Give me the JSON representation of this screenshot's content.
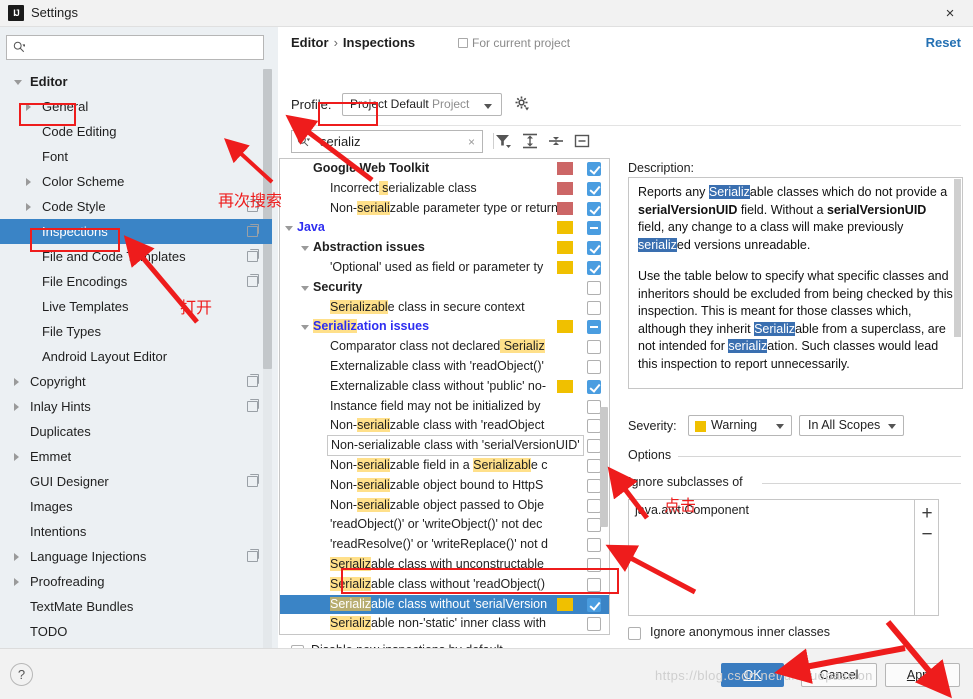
{
  "window": {
    "title": "Settings",
    "app_icon": "IJ",
    "close_icon": "×"
  },
  "sidebar": {
    "search_placeholder": "",
    "search_value": "",
    "items": [
      {
        "label": "Editor",
        "indent": 0,
        "arrow": "down",
        "copy": false,
        "selected": false,
        "bold": true
      },
      {
        "label": "General",
        "indent": 1,
        "arrow": "right",
        "copy": false,
        "selected": false,
        "bold": false
      },
      {
        "label": "Code Editing",
        "indent": 1,
        "arrow": "none",
        "copy": false,
        "selected": false,
        "bold": false
      },
      {
        "label": "Font",
        "indent": 1,
        "arrow": "none",
        "copy": false,
        "selected": false,
        "bold": false
      },
      {
        "label": "Color Scheme",
        "indent": 1,
        "arrow": "right",
        "copy": false,
        "selected": false,
        "bold": false
      },
      {
        "label": "Code Style",
        "indent": 1,
        "arrow": "right",
        "copy": true,
        "selected": false,
        "bold": false
      },
      {
        "label": "Inspections",
        "indent": 1,
        "arrow": "none",
        "copy": true,
        "selected": true,
        "bold": false
      },
      {
        "label": "File and Code Templates",
        "indent": 1,
        "arrow": "none",
        "copy": true,
        "selected": false,
        "bold": false
      },
      {
        "label": "File Encodings",
        "indent": 1,
        "arrow": "none",
        "copy": true,
        "selected": false,
        "bold": false
      },
      {
        "label": "Live Templates",
        "indent": 1,
        "arrow": "none",
        "copy": false,
        "selected": false,
        "bold": false
      },
      {
        "label": "File Types",
        "indent": 1,
        "arrow": "none",
        "copy": false,
        "selected": false,
        "bold": false
      },
      {
        "label": "Android Layout Editor",
        "indent": 1,
        "arrow": "none",
        "copy": false,
        "selected": false,
        "bold": false
      },
      {
        "label": "Copyright",
        "indent": 0,
        "arrow": "right",
        "copy": true,
        "selected": false,
        "bold": false
      },
      {
        "label": "Inlay Hints",
        "indent": 0,
        "arrow": "right",
        "copy": true,
        "selected": false,
        "bold": false
      },
      {
        "label": "Duplicates",
        "indent": 0,
        "arrow": "none",
        "copy": false,
        "selected": false,
        "bold": false
      },
      {
        "label": "Emmet",
        "indent": 0,
        "arrow": "right",
        "copy": false,
        "selected": false,
        "bold": false
      },
      {
        "label": "GUI Designer",
        "indent": 0,
        "arrow": "none",
        "copy": true,
        "selected": false,
        "bold": false
      },
      {
        "label": "Images",
        "indent": 0,
        "arrow": "none",
        "copy": false,
        "selected": false,
        "bold": false
      },
      {
        "label": "Intentions",
        "indent": 0,
        "arrow": "none",
        "copy": false,
        "selected": false,
        "bold": false
      },
      {
        "label": "Language Injections",
        "indent": 0,
        "arrow": "right",
        "copy": true,
        "selected": false,
        "bold": false
      },
      {
        "label": "Proofreading",
        "indent": 0,
        "arrow": "right",
        "copy": false,
        "selected": false,
        "bold": false
      },
      {
        "label": "TextMate Bundles",
        "indent": 0,
        "arrow": "none",
        "copy": false,
        "selected": false,
        "bold": false
      },
      {
        "label": "TODO",
        "indent": 0,
        "arrow": "none",
        "copy": false,
        "selected": false,
        "bold": false
      }
    ]
  },
  "header": {
    "breadcrumb_parent": "Editor",
    "breadcrumb_sep": "›",
    "breadcrumb_current": "Inspections",
    "for_current_project": "For current project",
    "reset": "Reset",
    "profile_label": "Profile:",
    "profile_value": "Project Default",
    "profile_scope": "Project",
    "gear_icon": "gear-icon"
  },
  "inspection_search": {
    "value": "serializ",
    "clear_icon": "×",
    "filter_icon": "filter-icon",
    "expand_all_icon": "expand-all-icon",
    "collapse_all_icon": "collapse-all-icon",
    "collapse_box_icon": "collapse-box-icon"
  },
  "inspection_tree": {
    "tooltip": "Non-serializable class with 'serialVersionUID'",
    "rows": [
      {
        "label": "Google Web Toolkit",
        "indent": 1,
        "arrow": "none",
        "bold": true,
        "blue": false,
        "severity": "error",
        "check": "on",
        "selected": false,
        "marks": []
      },
      {
        "label": "Incorrect serializable class",
        "indent": 2,
        "arrow": "none",
        "bold": false,
        "blue": false,
        "severity": "error",
        "check": "on",
        "selected": false,
        "marks": [
          [
            9,
            11
          ]
        ]
      },
      {
        "label": "Non-serializable parameter type or return",
        "indent": 2,
        "arrow": "none",
        "bold": false,
        "blue": false,
        "severity": "error",
        "check": "on",
        "selected": false,
        "marks": [
          [
            4,
            11
          ]
        ]
      },
      {
        "label": "Java",
        "indent": 0,
        "arrow": "down",
        "bold": true,
        "blue": true,
        "severity": "warning",
        "check": "partial",
        "selected": false,
        "marks": []
      },
      {
        "label": "Abstraction issues",
        "indent": 1,
        "arrow": "down",
        "bold": true,
        "blue": false,
        "severity": "warning",
        "check": "on",
        "selected": false,
        "marks": []
      },
      {
        "label": "'Optional' used as field or parameter ty",
        "indent": 2,
        "arrow": "none",
        "bold": false,
        "blue": false,
        "severity": "warning",
        "check": "on",
        "selected": false,
        "marks": []
      },
      {
        "label": "Security",
        "indent": 1,
        "arrow": "down",
        "bold": true,
        "blue": false,
        "severity": "none",
        "check": "off",
        "selected": false,
        "marks": []
      },
      {
        "label": "Serializable class in secure context",
        "indent": 2,
        "arrow": "none",
        "bold": false,
        "blue": false,
        "severity": "none",
        "check": "off",
        "selected": false,
        "marks": [
          [
            0,
            11
          ]
        ]
      },
      {
        "label": "Serialization issues",
        "indent": 1,
        "arrow": "down",
        "bold": true,
        "blue": true,
        "severity": "warning",
        "check": "partial",
        "selected": false,
        "marks": [
          [
            0,
            8
          ]
        ]
      },
      {
        "label": "Comparator class not declared Serializ",
        "indent": 2,
        "arrow": "none",
        "bold": false,
        "blue": false,
        "severity": "none",
        "check": "off",
        "selected": false,
        "marks": [
          [
            29,
            38
          ]
        ]
      },
      {
        "label": "Externalizable class with 'readObject()'",
        "indent": 2,
        "arrow": "none",
        "bold": false,
        "blue": false,
        "severity": "none",
        "check": "off",
        "selected": false,
        "marks": []
      },
      {
        "label": "Externalizable class without 'public' no-",
        "indent": 2,
        "arrow": "none",
        "bold": false,
        "blue": false,
        "severity": "warning",
        "check": "on",
        "selected": false,
        "marks": []
      },
      {
        "label": "Instance field may not be initialized by",
        "indent": 2,
        "arrow": "none",
        "bold": false,
        "blue": false,
        "severity": "none",
        "check": "off",
        "selected": false,
        "marks": []
      },
      {
        "label": "Non-serializable class with 'readObject",
        "indent": 2,
        "arrow": "none",
        "bold": false,
        "blue": false,
        "severity": "none",
        "check": "off",
        "selected": false,
        "marks": [
          [
            4,
            11
          ]
        ]
      },
      {
        "label": "Non-serializable class with 'serialVersionUID'",
        "indent": 2,
        "arrow": "none",
        "bold": false,
        "blue": false,
        "severity": "none",
        "check": "off",
        "selected": false,
        "marks": [
          [
            4,
            11
          ]
        ]
      },
      {
        "label": "Non-serializable field in a Serializable c",
        "indent": 2,
        "arrow": "none",
        "bold": false,
        "blue": false,
        "severity": "none",
        "check": "off",
        "selected": false,
        "marks": [
          [
            4,
            11
          ],
          [
            28,
            39
          ]
        ]
      },
      {
        "label": "Non-serializable object bound to HttpS",
        "indent": 2,
        "arrow": "none",
        "bold": false,
        "blue": false,
        "severity": "none",
        "check": "off",
        "selected": false,
        "marks": [
          [
            4,
            11
          ]
        ]
      },
      {
        "label": "Non-serializable object passed to Obje",
        "indent": 2,
        "arrow": "none",
        "bold": false,
        "blue": false,
        "severity": "none",
        "check": "off",
        "selected": false,
        "marks": [
          [
            4,
            11
          ]
        ]
      },
      {
        "label": "'readObject()' or 'writeObject()' not dec",
        "indent": 2,
        "arrow": "none",
        "bold": false,
        "blue": false,
        "severity": "none",
        "check": "off",
        "selected": false,
        "marks": []
      },
      {
        "label": "'readResolve()' or 'writeReplace()' not d",
        "indent": 2,
        "arrow": "none",
        "bold": false,
        "blue": false,
        "severity": "none",
        "check": "off",
        "selected": false,
        "marks": []
      },
      {
        "label": "Serializable class with unconstructable",
        "indent": 2,
        "arrow": "none",
        "bold": false,
        "blue": false,
        "severity": "none",
        "check": "off",
        "selected": false,
        "marks": [
          [
            0,
            8
          ]
        ]
      },
      {
        "label": "Serializable class without 'readObject()",
        "indent": 2,
        "arrow": "none",
        "bold": false,
        "blue": false,
        "severity": "none",
        "check": "off",
        "selected": false,
        "marks": [
          [
            0,
            8
          ]
        ]
      },
      {
        "label": "Serializable class without 'serialVersion",
        "indent": 2,
        "arrow": "none",
        "bold": false,
        "blue": false,
        "severity": "warning",
        "check": "on",
        "selected": true,
        "marks": [
          [
            0,
            8
          ]
        ]
      },
      {
        "label": "Serializable non-'static' inner class with",
        "indent": 2,
        "arrow": "none",
        "bold": false,
        "blue": false,
        "severity": "none",
        "check": "off",
        "selected": false,
        "marks": [
          [
            0,
            8
          ]
        ]
      }
    ]
  },
  "disable_new": {
    "label": "Disable new inspections by default",
    "checked": false
  },
  "description": {
    "label": "Description:",
    "para1_pre": "Reports any ",
    "para1_hl1": "Serializ",
    "para1_mid1": "able classes which do not provide a ",
    "para1_b1": "serialVersionUID",
    "para1_mid2": " field. Without a ",
    "para1_b2": "serialVersionUID",
    "para1_mid3": " field, any change to a class will make previously ",
    "para1_hl2": "serializ",
    "para1_end": "ed versions unreadable.",
    "para2_pre": "Use the table below to specify what specific classes and inheritors should be excluded from being checked by this inspection. This is meant for those classes which, although they inherit ",
    "para2_hl1": "Serializ",
    "para2_mid": "able from a superclass, are not intended for ",
    "para2_hl2": "serializ",
    "para2_end": "ation. Such classes would lead this inspection to report unnecessarily."
  },
  "severity": {
    "label": "Severity:",
    "value": "Warning",
    "color": "#f0c000",
    "scope": "In All Scopes"
  },
  "options": {
    "title": "Options",
    "ignore_subclasses_title": "Ignore subclasses of",
    "list_items": [
      "java.awt.Component"
    ],
    "add_icon": "+",
    "remove_icon": "−",
    "ignore_anonymous_label": "Ignore anonymous inner classes",
    "ignore_anonymous_checked": false
  },
  "footer": {
    "help_icon": "?",
    "ok": "OK",
    "cancel": "Cancel",
    "apply": "Apply"
  },
  "annotations": {
    "note_search_again": "再次搜索",
    "note_open": "打开",
    "note_click": "点击",
    "watermark": "https://blog.csdn.net/uniquepassion"
  }
}
